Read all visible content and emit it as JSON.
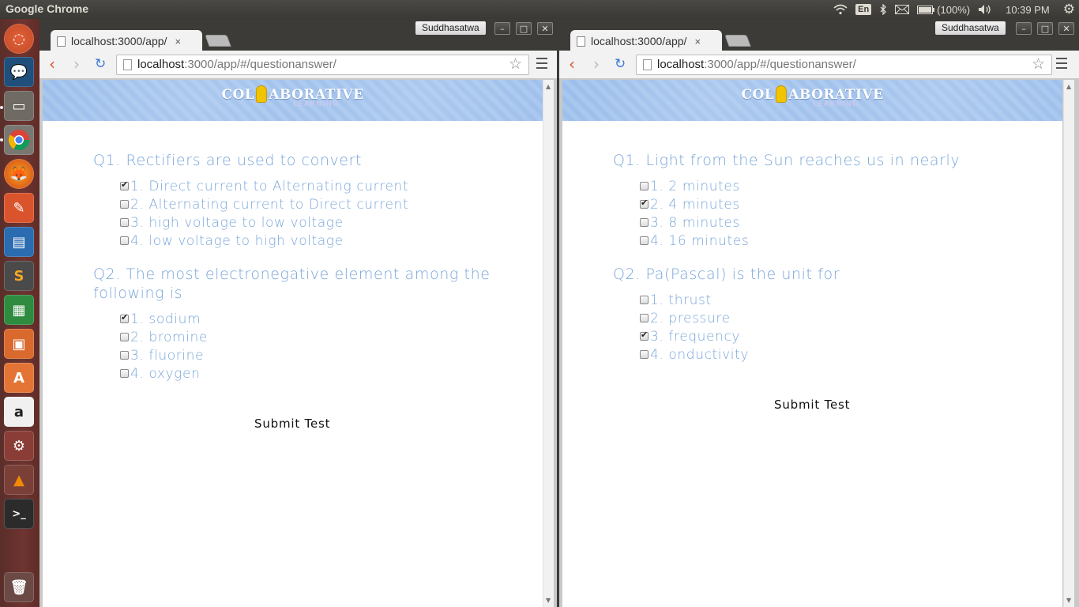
{
  "top_panel": {
    "app_title": "Google Chrome",
    "lang": "En",
    "battery": "(100%)",
    "clock": "10:39 PM"
  },
  "launcher": {
    "icons": [
      "ubuntu-dash-icon",
      "chat-icon",
      "files-icon",
      "chrome-icon",
      "firefox-icon",
      "tools-icon",
      "writer-icon",
      "sublime-icon",
      "calc-icon",
      "impress-icon",
      "software-center-icon",
      "amazon-icon",
      "settings-icon",
      "vlc-icon",
      "terminal-icon",
      "trash-icon"
    ]
  },
  "windows": [
    {
      "profile": "Suddhasatwa",
      "tab_title": "localhost:3000/app/",
      "url_host": "localhost",
      "url_rest": ":3000/app/#/questionanswer/",
      "logo_main": "COL ABORATIVE",
      "logo_sub": "LEARNING",
      "questions": [
        {
          "text": "Q1. Rectifiers are used to convert",
          "options": [
            {
              "label": "1. Direct current to Alternating current",
              "checked": true
            },
            {
              "label": "2. Alternating current to Direct current",
              "checked": false
            },
            {
              "label": "3. high voltage to low voltage",
              "checked": false
            },
            {
              "label": "4. low voltage to high voltage",
              "checked": false
            }
          ]
        },
        {
          "text": "Q2. The most electronegative element among the following is",
          "options": [
            {
              "label": "1. sodium",
              "checked": true
            },
            {
              "label": "2. bromine",
              "checked": false
            },
            {
              "label": "3. fluorine",
              "checked": false
            },
            {
              "label": "4. oxygen",
              "checked": false
            }
          ]
        }
      ],
      "submit_label": "Submit Test"
    },
    {
      "profile": "Suddhasatwa",
      "tab_title": "localhost:3000/app/",
      "url_host": "localhost",
      "url_rest": ":3000/app/#/questionanswer/",
      "logo_main": "COL ABORATIVE",
      "logo_sub": "LEARNING",
      "questions": [
        {
          "text": "Q1. Light from the Sun reaches us in nearly",
          "options": [
            {
              "label": "1. 2 minutes",
              "checked": false
            },
            {
              "label": "2. 4 minutes",
              "checked": true
            },
            {
              "label": "3. 8 minutes",
              "checked": false
            },
            {
              "label": "4. 16 minutes",
              "checked": false
            }
          ]
        },
        {
          "text": "Q2. Pa(Pascal) is the unit for",
          "options": [
            {
              "label": "1. thrust",
              "checked": false
            },
            {
              "label": "2. pressure",
              "checked": false
            },
            {
              "label": "3. frequency",
              "checked": true
            },
            {
              "label": "4. onductivity",
              "checked": false
            }
          ]
        }
      ],
      "submit_label": "Submit Test"
    }
  ]
}
